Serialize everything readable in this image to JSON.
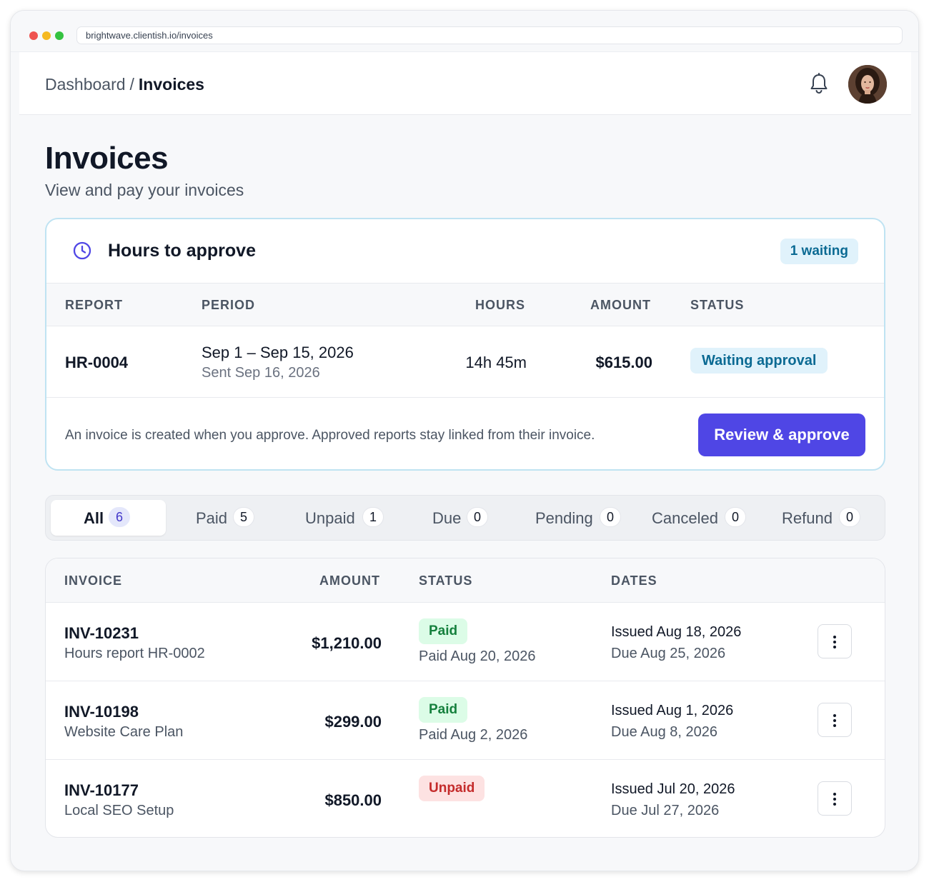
{
  "browser": {
    "url": "brightwave.clientish.io/invoices"
  },
  "header": {
    "breadcrumb": {
      "parent": "Dashboard",
      "separator": "/",
      "current": "Invoices"
    },
    "icons": {
      "notifications": "bell-icon",
      "avatar": "user-avatar"
    }
  },
  "page": {
    "title": "Invoices",
    "subtitle": "View and pay your invoices"
  },
  "approval": {
    "title": "Hours to approve",
    "icon": "clock-icon",
    "badge": "1 waiting",
    "columns": {
      "report": "REPORT",
      "period": "PERIOD",
      "hours": "HOURS",
      "amount": "AMOUNT",
      "status": "STATUS"
    },
    "row": {
      "report": "HR-0004",
      "period": "Sep 1 – Sep 15, 2026",
      "sent": "Sent Sep 16, 2026",
      "hours": "14h 45m",
      "amount": "$615.00",
      "status": "Waiting approval"
    },
    "note": "An invoice is created when you approve. Approved reports stay linked from their invoice.",
    "button": "Review & approve"
  },
  "tabs": [
    {
      "label": "All",
      "count": "6",
      "active": true
    },
    {
      "label": "Paid",
      "count": "5"
    },
    {
      "label": "Unpaid",
      "count": "1"
    },
    {
      "label": "Due",
      "count": "0"
    },
    {
      "label": "Pending",
      "count": "0"
    },
    {
      "label": "Canceled",
      "count": "0"
    },
    {
      "label": "Refund",
      "count": "0"
    }
  ],
  "invoices": {
    "columns": {
      "invoice": "INVOICE",
      "amount": "AMOUNT",
      "status": "STATUS",
      "dates": "DATES"
    },
    "rows": [
      {
        "id": "INV-10231",
        "desc": "Hours report HR-0002",
        "amount": "$1,210.00",
        "status": "Paid",
        "paid": "Paid Aug 20, 2026",
        "issued": "Issued Aug 18, 2026",
        "due": "Due Aug 25, 2026"
      },
      {
        "id": "INV-10198",
        "desc": "Website Care Plan",
        "amount": "$299.00",
        "status": "Paid",
        "paid": "Paid Aug 2, 2026",
        "issued": "Issued Aug 1, 2026",
        "due": "Due Aug 8, 2026"
      },
      {
        "id": "INV-10177",
        "desc": "Local SEO Setup",
        "amount": "$850.00",
        "status": "Unpaid",
        "paid": "",
        "issued": "Issued Jul 20, 2026",
        "due": "Due Jul 27, 2026"
      }
    ]
  },
  "colors": {
    "primary": "#4f46e5",
    "info_bg": "#e0f2fb",
    "info_text": "#0b6a93",
    "paid_bg": "#dcfce7",
    "paid_text": "#15803d",
    "unpaid_bg": "#fde2e2",
    "unpaid_text": "#c42b2b"
  }
}
